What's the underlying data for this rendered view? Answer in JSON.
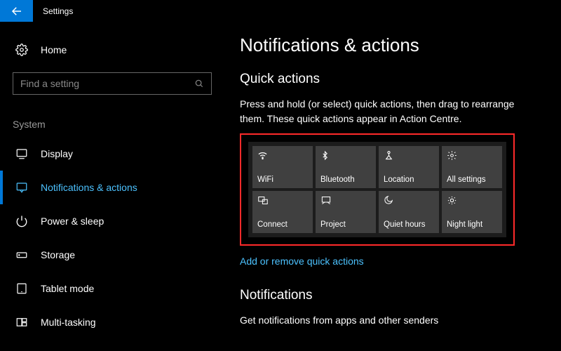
{
  "titlebar": {
    "app_name": "Settings"
  },
  "sidebar": {
    "home_label": "Home",
    "search_placeholder": "Find a setting",
    "group_label": "System",
    "items": [
      {
        "label": "Display"
      },
      {
        "label": "Notifications & actions"
      },
      {
        "label": "Power & sleep"
      },
      {
        "label": "Storage"
      },
      {
        "label": "Tablet mode"
      },
      {
        "label": "Multi-tasking"
      }
    ]
  },
  "main": {
    "page_title": "Notifications & actions",
    "quick_actions": {
      "heading": "Quick actions",
      "description": "Press and hold (or select) quick actions, then drag to rearrange them. These quick actions appear in Action Centre.",
      "tiles": [
        {
          "label": "WiFi"
        },
        {
          "label": "Bluetooth"
        },
        {
          "label": "Location"
        },
        {
          "label": "All settings"
        },
        {
          "label": "Connect"
        },
        {
          "label": "Project"
        },
        {
          "label": "Quiet hours"
        },
        {
          "label": "Night light"
        }
      ],
      "link": "Add or remove quick actions"
    },
    "notifications": {
      "heading": "Notifications",
      "description": "Get notifications from apps and other senders"
    }
  }
}
